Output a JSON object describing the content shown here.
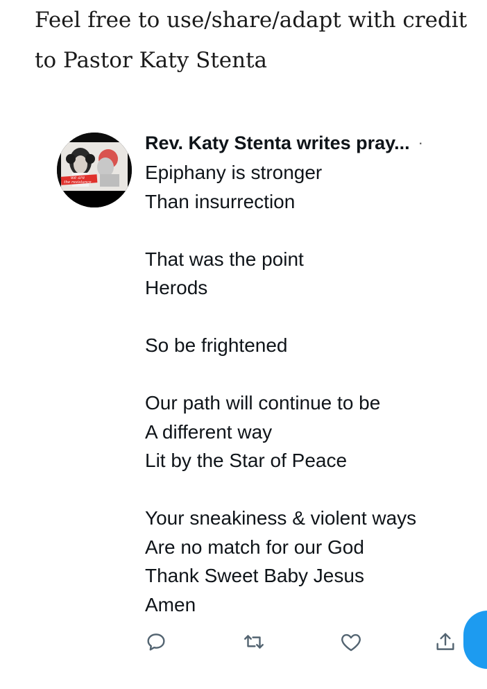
{
  "caption": {
    "line1": "Feel free to use/share/adapt with credit",
    "line2": "to Pastor Katy Stenta"
  },
  "tweet": {
    "author": "Rev. Katy Stenta writes pray...",
    "more_dot": "·",
    "avatar_labels": [
      "we are",
      "the resistance"
    ],
    "lines": [
      "Epiphany is stronger",
      "Than insurrection",
      "",
      "That was the point",
      "Herods",
      "",
      "So be frightened",
      "",
      "Our path will continue to be",
      "A different way",
      "Lit by the Star of Peace",
      "",
      "Your sneakiness & violent ways",
      "Are no match for our God",
      "Thank Sweet Baby Jesus",
      "Amen"
    ]
  },
  "actions": [
    "reply-icon",
    "retweet-icon",
    "like-icon",
    "share-icon"
  ],
  "colors": {
    "text": "#0f1419",
    "caption_text": "#1a1a1a",
    "icon": "#536471",
    "accent": "#1d9bf0"
  }
}
